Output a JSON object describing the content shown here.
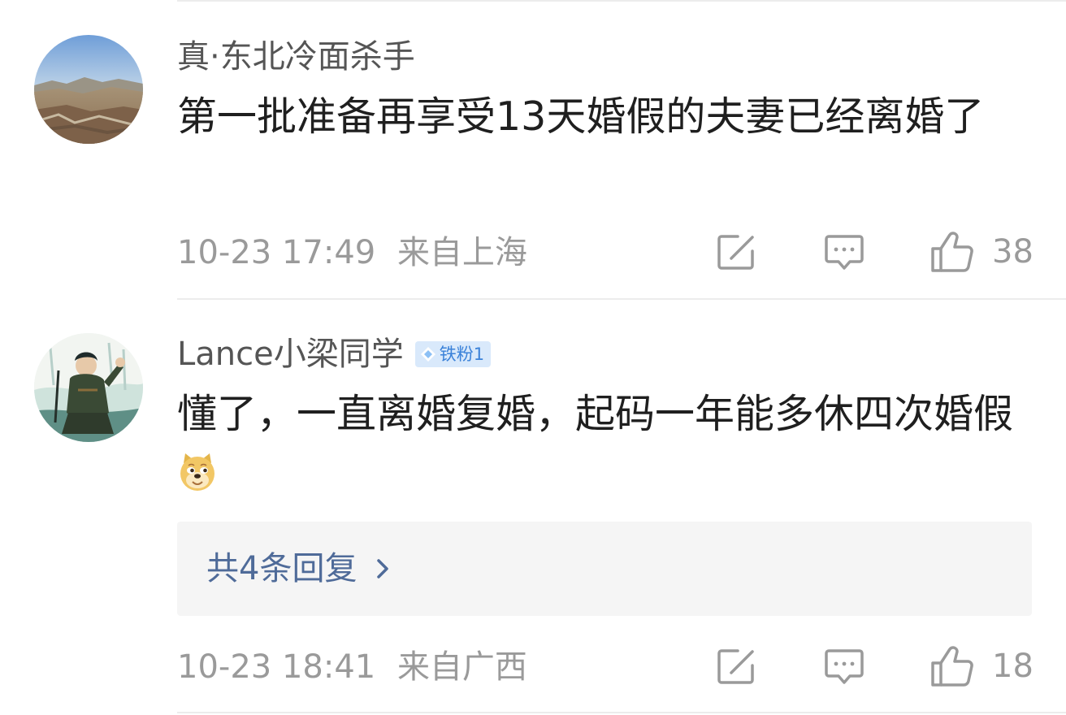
{
  "comments": [
    {
      "username": "真·东北冷面杀手",
      "text": "第一批准备再享受13天婚假的夫妻已经离婚了",
      "timestamp": "10-23 17:49",
      "location": "来自上海",
      "likes": "38",
      "avatar": "landscape-photo"
    },
    {
      "username": "Lance小梁同学",
      "badge": "铁粉1",
      "text": "懂了，一直离婚复婚，起码一年能多休四次婚假",
      "emoji": "doge-emoji",
      "timestamp": "10-23 18:41",
      "location": "来自广西",
      "likes": "18",
      "avatar": "anime-character",
      "replies_label": "共4条回复"
    }
  ],
  "icons": {
    "share": "share-edit-icon",
    "comment": "comment-icon",
    "like": "thumbs-up-icon"
  },
  "colors": {
    "reply_link": "#4f6b99",
    "badge_bg": "#d9e9fb",
    "badge_text": "#3b82d9",
    "meta_text": "#9a9a9a"
  }
}
